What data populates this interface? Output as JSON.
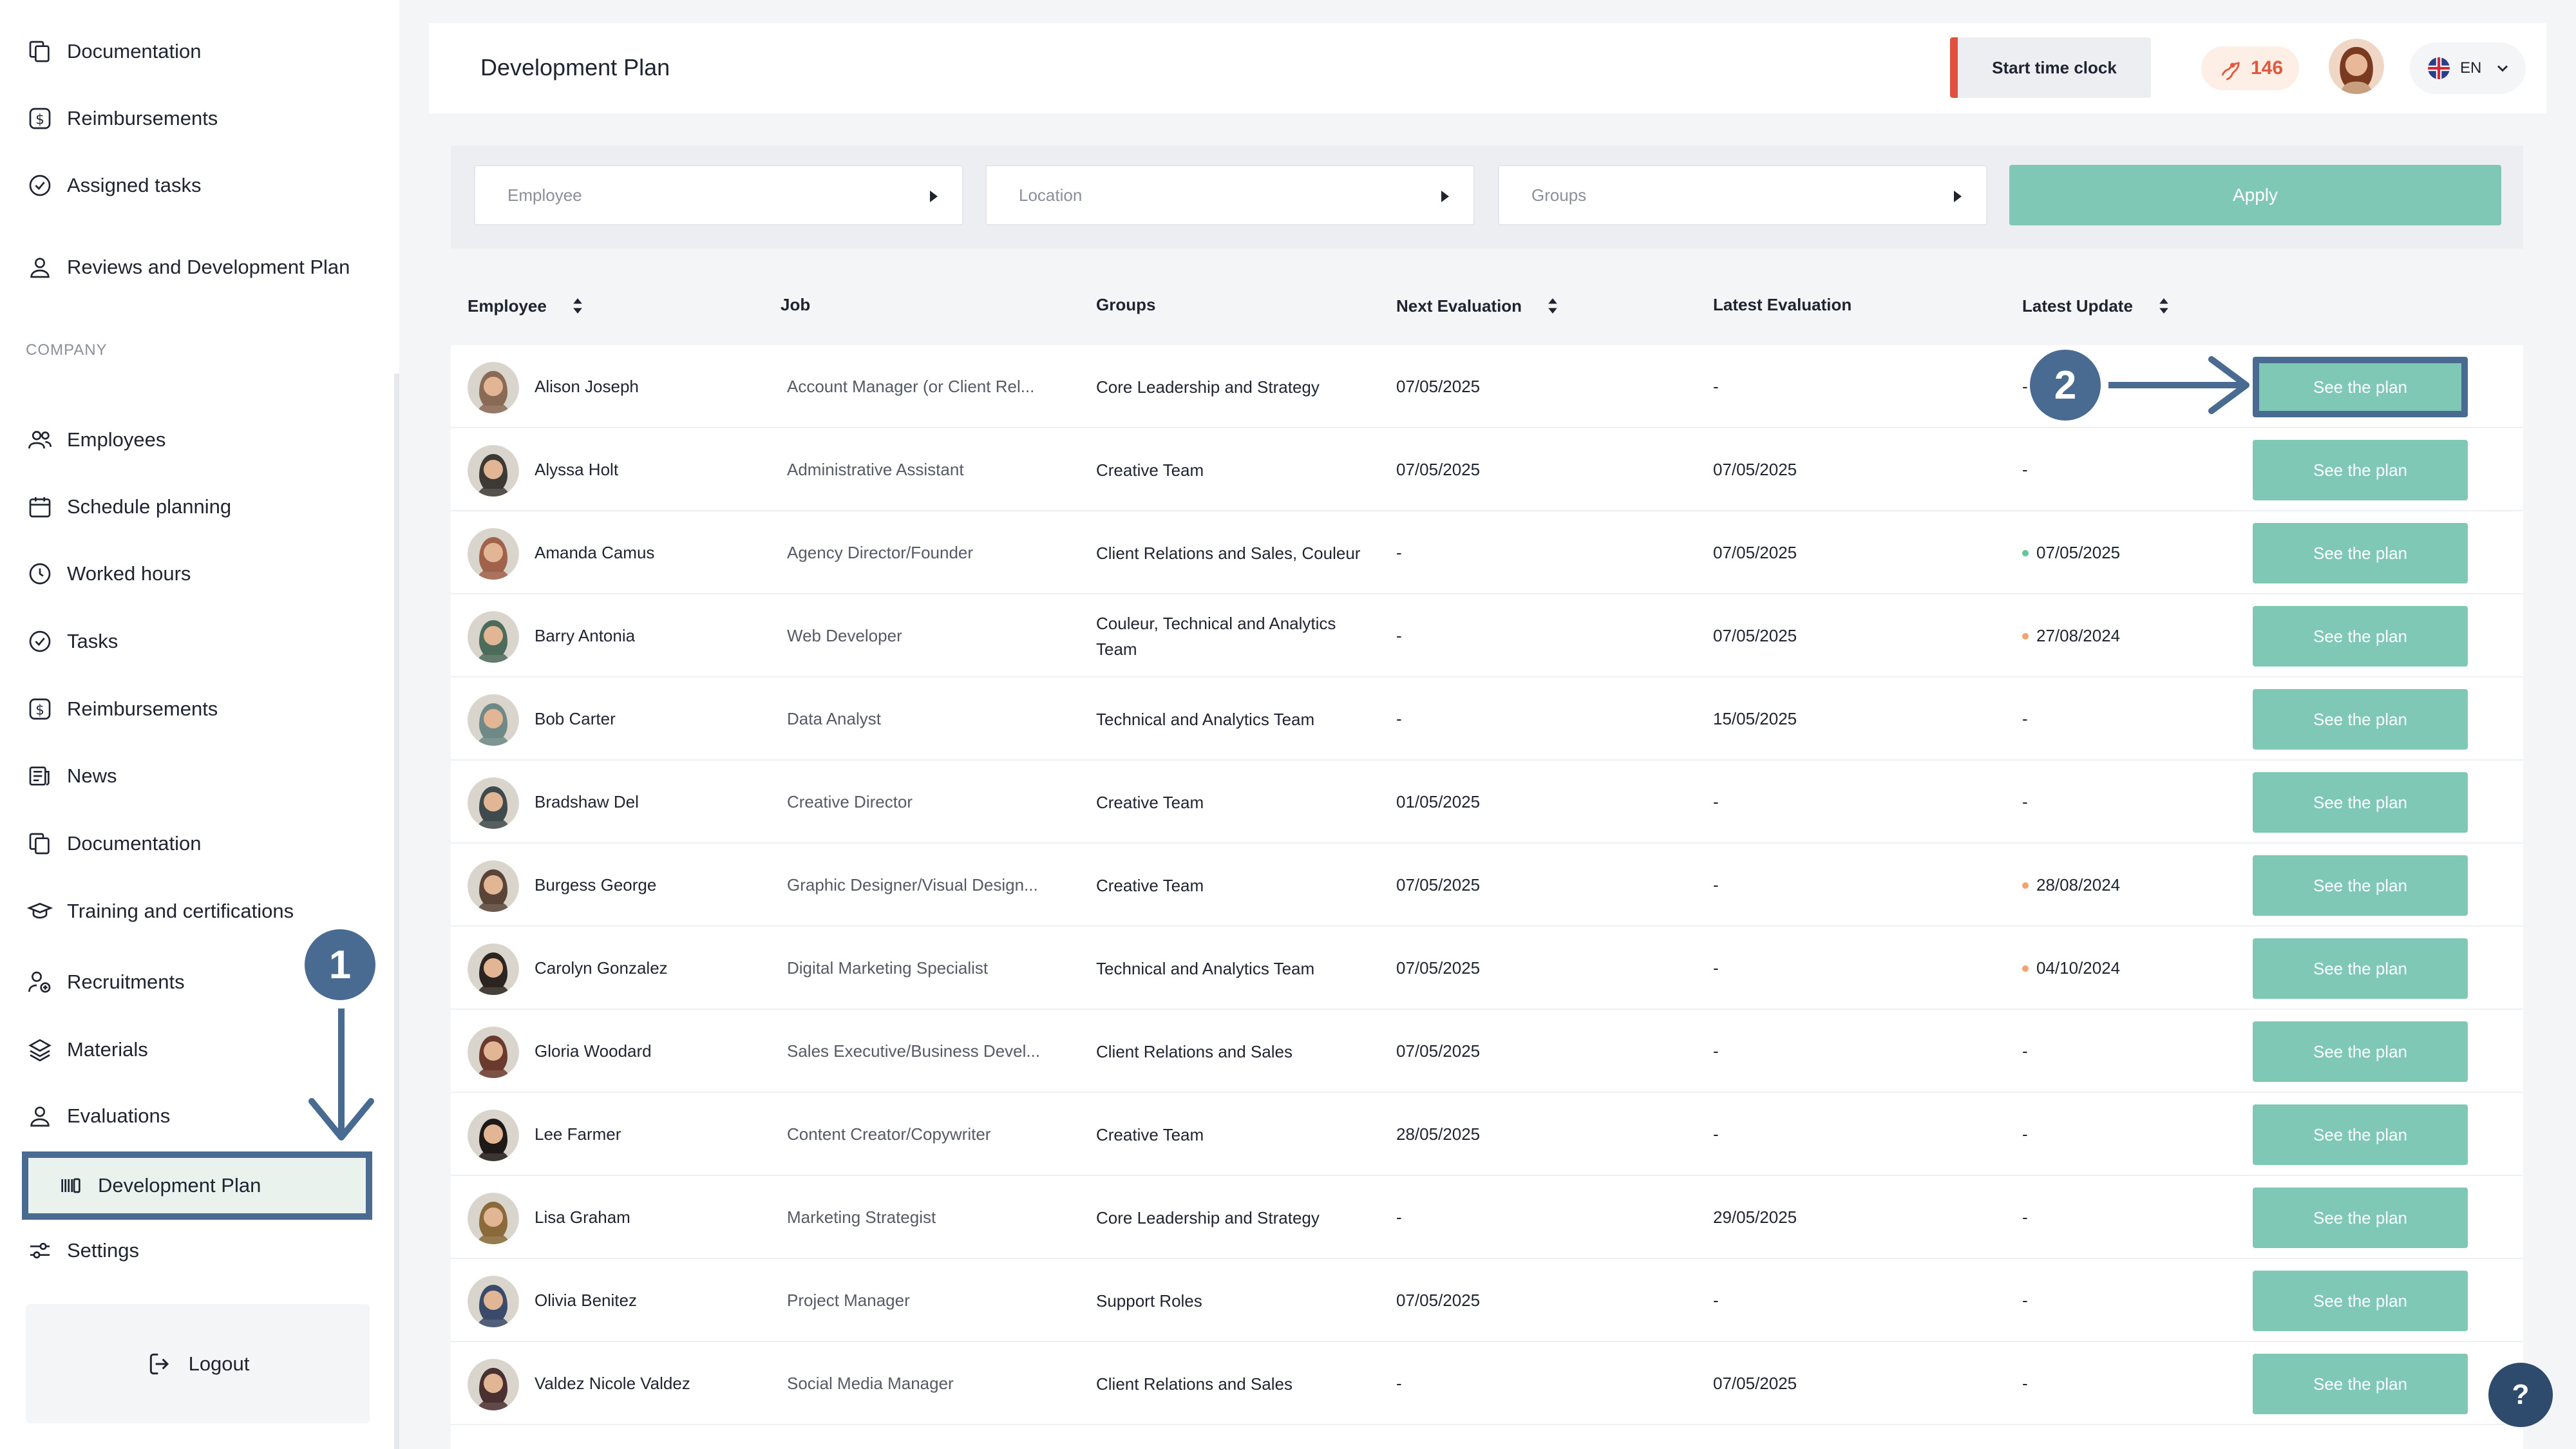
{
  "sidebar": {
    "top_items": [
      {
        "label": "Documentation",
        "icon": "documents-icon"
      },
      {
        "label": "Reimbursements",
        "icon": "dollar-icon"
      },
      {
        "label": "Assigned tasks",
        "icon": "check-circle-icon"
      },
      {
        "label": "Reviews and Development Plan",
        "icon": "user-icon"
      }
    ],
    "section_label": "COMPANY",
    "company_items": [
      {
        "label": "Employees",
        "icon": "users-icon"
      },
      {
        "label": "Schedule planning",
        "icon": "calendar-icon"
      },
      {
        "label": "Worked hours",
        "icon": "clock-icon"
      },
      {
        "label": "Tasks",
        "icon": "check-circle-icon"
      },
      {
        "label": "Reimbursements",
        "icon": "dollar-icon"
      },
      {
        "label": "News",
        "icon": "news-icon"
      },
      {
        "label": "Documentation",
        "icon": "documents-icon"
      },
      {
        "label": "Training and certifications",
        "icon": "graduation-cap-icon"
      },
      {
        "label": "Recruitments",
        "icon": "recruit-icon"
      },
      {
        "label": "Materials",
        "icon": "layers-icon"
      },
      {
        "label": "Evaluations",
        "icon": "user-icon"
      }
    ],
    "active_item": {
      "label": "Development Plan",
      "icon": "barcode-icon"
    },
    "settings": {
      "label": "Settings",
      "icon": "sliders-icon"
    },
    "logout": {
      "label": "Logout",
      "icon": "logout-icon"
    }
  },
  "annotations": {
    "marker_1": "1",
    "marker_2": "2"
  },
  "header": {
    "title": "Development Plan",
    "time_clock_label": "Start time clock",
    "points": "146",
    "language": "EN"
  },
  "filters": {
    "employee_placeholder": "Employee",
    "location_placeholder": "Location",
    "groups_placeholder": "Groups",
    "apply_label": "Apply"
  },
  "table": {
    "headers": {
      "employee": "Employee",
      "job": "Job",
      "groups": "Groups",
      "next_evaluation": "Next Evaluation",
      "latest_evaluation": "Latest Evaluation",
      "latest_update": "Latest Update"
    },
    "action_label": "See the plan",
    "rows": [
      {
        "name": "Alison Joseph",
        "job": "Account Manager (or Client Rel...",
        "groups": "Core Leadership and Strategy",
        "next": "07/05/2025",
        "latest": "-",
        "update": "-",
        "dot": "",
        "avatar": "#8a6a55"
      },
      {
        "name": "Alyssa Holt",
        "job": "Administrative Assistant",
        "groups": "Creative Team",
        "next": "07/05/2025",
        "latest": "07/05/2025",
        "update": "-",
        "dot": "",
        "avatar": "#3d3a36"
      },
      {
        "name": "Amanda Camus",
        "job": "Agency Director/Founder",
        "groups": "Client Relations and Sales, Couleur",
        "next": "-",
        "latest": "07/05/2025",
        "update": "07/05/2025",
        "dot": "#5ec79a",
        "avatar": "#a0624a"
      },
      {
        "name": "Barry Antonia",
        "job": "Web Developer",
        "groups": "Couleur, Technical and Analytics Team",
        "next": "-",
        "latest": "07/05/2025",
        "update": "27/08/2024",
        "dot": "#f5a26e",
        "avatar": "#4d6b5a"
      },
      {
        "name": "Bob Carter",
        "job": "Data Analyst",
        "groups": "Technical and Analytics Team",
        "next": "-",
        "latest": "15/05/2025",
        "update": "-",
        "dot": "",
        "avatar": "#6f8a86"
      },
      {
        "name": "Bradshaw Del",
        "job": "Creative Director",
        "groups": "Creative Team",
        "next": "01/05/2025",
        "latest": "-",
        "update": "-",
        "dot": "",
        "avatar": "#3f4a4c"
      },
      {
        "name": "Burgess George",
        "job": "Graphic Designer/Visual Design...",
        "groups": "Creative Team",
        "next": "07/05/2025",
        "latest": "-",
        "update": "28/08/2024",
        "dot": "#f5a26e",
        "avatar": "#5a4438"
      },
      {
        "name": "Carolyn Gonzalez",
        "job": "Digital Marketing Specialist",
        "groups": "Technical and Analytics Team",
        "next": "07/05/2025",
        "latest": "-",
        "update": "04/10/2024",
        "dot": "#f5a26e",
        "avatar": "#2c2420"
      },
      {
        "name": "Gloria Woodard",
        "job": "Sales Executive/Business Devel...",
        "groups": "Client Relations and Sales",
        "next": "07/05/2025",
        "latest": "-",
        "update": "-",
        "dot": "",
        "avatar": "#6b3a2e"
      },
      {
        "name": "Lee Farmer",
        "job": "Content Creator/Copywriter",
        "groups": "Creative Team",
        "next": "28/05/2025",
        "latest": "-",
        "update": "-",
        "dot": "",
        "avatar": "#1e1a18"
      },
      {
        "name": "Lisa Graham",
        "job": "Marketing Strategist",
        "groups": "Core Leadership and Strategy",
        "next": "-",
        "latest": "29/05/2025",
        "update": "-",
        "dot": "",
        "avatar": "#8a6a3a"
      },
      {
        "name": "Olivia Benitez",
        "job": "Project Manager",
        "groups": "Support Roles",
        "next": "07/05/2025",
        "latest": "-",
        "update": "-",
        "dot": "",
        "avatar": "#3a4a6a"
      },
      {
        "name": "Valdez Nicole Valdez",
        "job": "Social Media Manager",
        "groups": "Client Relations and Sales",
        "next": "-",
        "latest": "07/05/2025",
        "update": "-",
        "dot": "",
        "avatar": "#4a3030"
      }
    ]
  },
  "help_label": "?"
}
